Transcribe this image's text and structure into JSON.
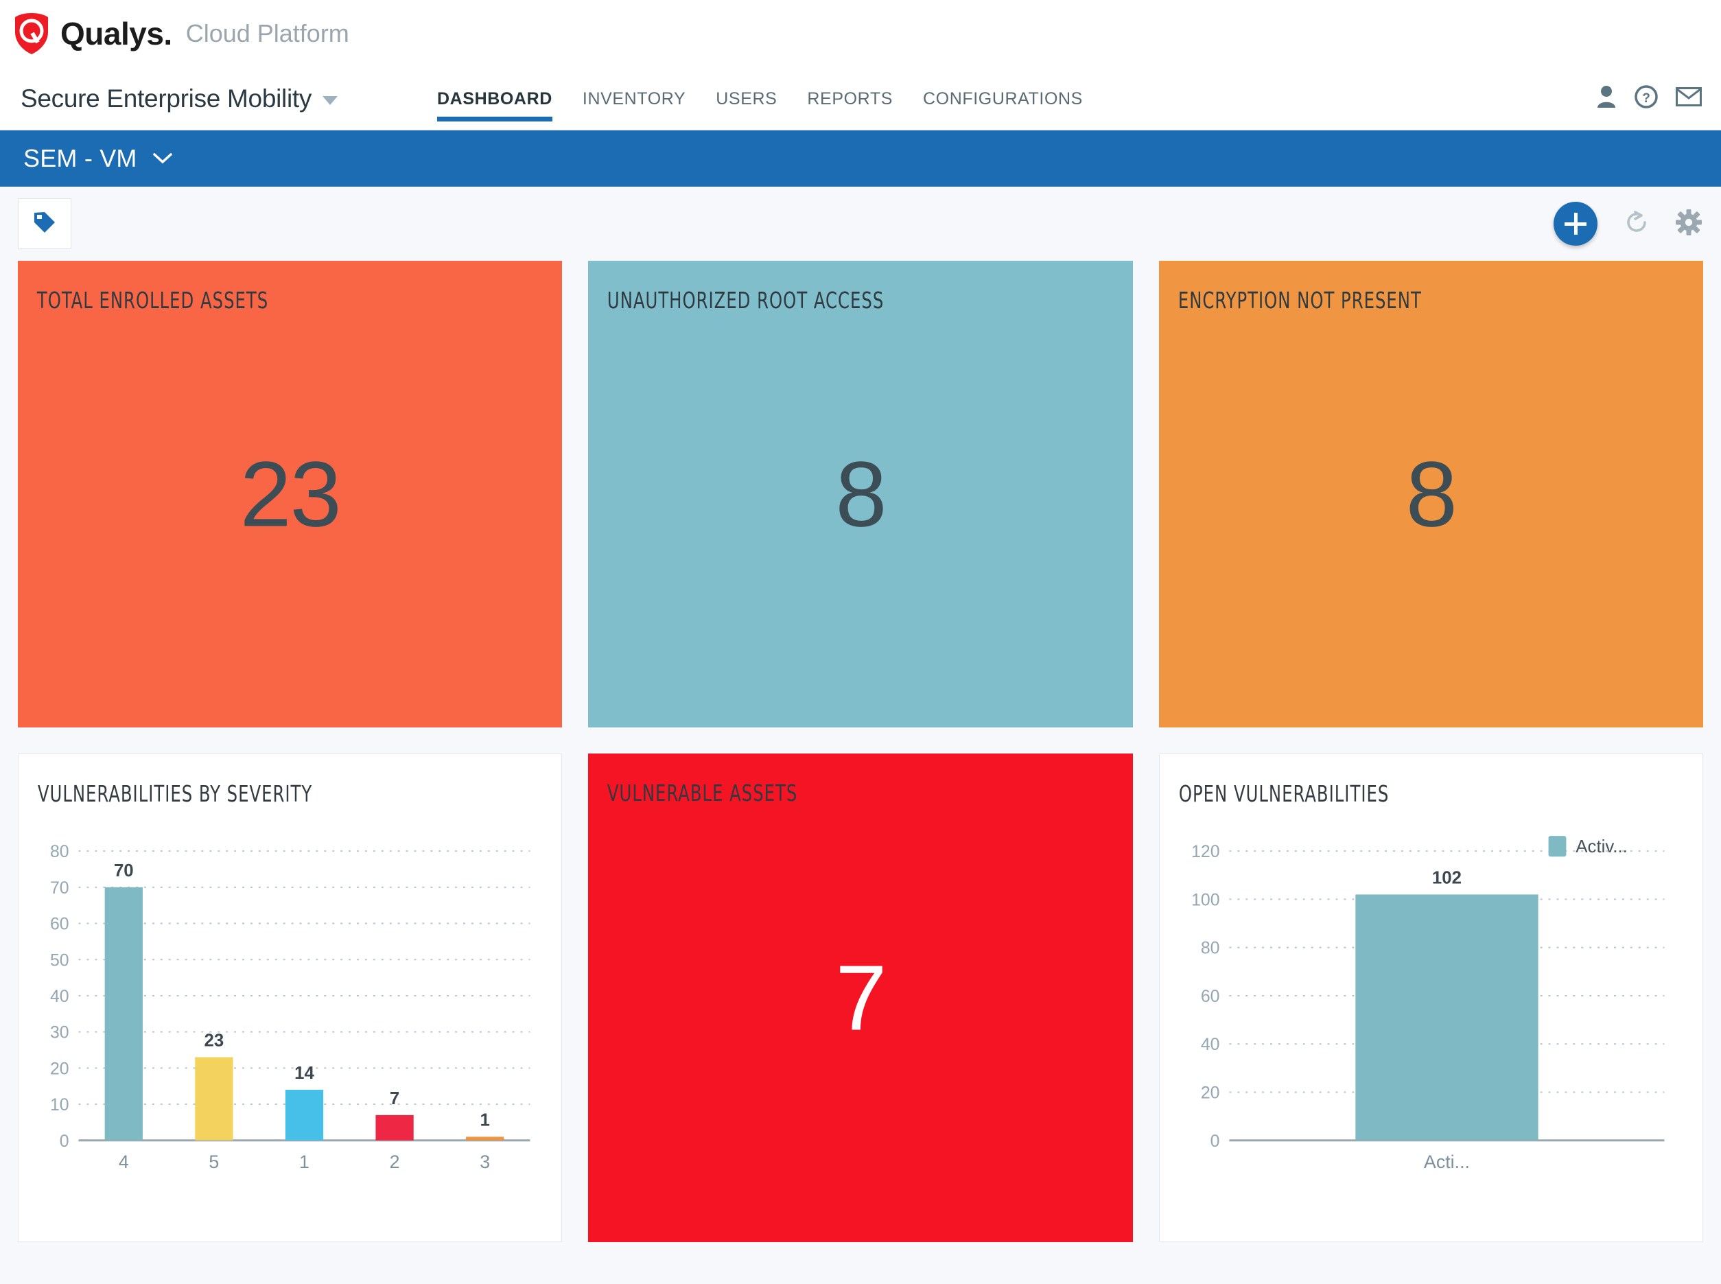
{
  "brand": {
    "name": "Qualys",
    "name_punct": ".",
    "suffix": "Cloud Platform",
    "logo_icon": "qualys-shield-logo",
    "logo_color": "#ED1C24"
  },
  "header": {
    "module_title": "Secure Enterprise Mobility",
    "module_caret_icon": "caret-down-icon",
    "nav": [
      {
        "label": "DASHBOARD",
        "active": true
      },
      {
        "label": "INVENTORY",
        "active": false
      },
      {
        "label": "USERS",
        "active": false
      },
      {
        "label": "REPORTS",
        "active": false
      },
      {
        "label": "CONFIGURATIONS",
        "active": false
      }
    ],
    "actions": [
      {
        "icon": "user-icon"
      },
      {
        "icon": "help-question-icon"
      },
      {
        "icon": "mail-envelope-icon"
      }
    ],
    "active_accent": "#1a6db5"
  },
  "context_bar": {
    "label": "SEM - VM",
    "chevron_icon": "chevron-down-icon",
    "background": "#1b6cb3"
  },
  "toolbar": {
    "tag_icon": "tag-icon",
    "add_icon": "plus-icon",
    "refresh_icon": "refresh-icon",
    "settings_icon": "gear-icon",
    "add_button_color": "#1b6cb3"
  },
  "widgets": [
    {
      "title": "TOTAL ENROLLED ASSETS",
      "value": "23",
      "background": "#f96645",
      "text_color": "#3d4d56",
      "kind": "counter"
    },
    {
      "title": "UNAUTHORIZED ROOT ACCESS",
      "value": "8",
      "background": "#80becb",
      "text_color": "#3d4d56",
      "kind": "counter"
    },
    {
      "title": "ENCRYPTION NOT PRESENT",
      "value": "8",
      "background": "#f09541",
      "text_color": "#3d4d56",
      "kind": "counter"
    },
    {
      "title": "VULNERABILITIES BY SEVERITY",
      "background": "#ffffff",
      "kind": "chart"
    },
    {
      "title": "VULNERABLE ASSETS",
      "value": "7",
      "background": "#f41424",
      "text_color": "#ffffff",
      "kind": "counter"
    },
    {
      "title": "OPEN VULNERABILITIES",
      "background": "#ffffff",
      "kind": "chart"
    }
  ],
  "chart_data": [
    {
      "type": "bar",
      "title": "VULNERABILITIES BY SEVERITY",
      "categories": [
        "4",
        "5",
        "1",
        "2",
        "3"
      ],
      "values": [
        70,
        23,
        14,
        7,
        1
      ],
      "colors": [
        "#7fb9c4",
        "#f3d35e",
        "#46c0e8",
        "#ed2744",
        "#f09541"
      ],
      "xlabel": "",
      "ylabel": "",
      "ylim": [
        0,
        80
      ],
      "yticks": [
        0,
        10,
        20,
        30,
        40,
        50,
        60,
        70,
        80
      ],
      "grid": true,
      "legend": false,
      "data_labels": true
    },
    {
      "type": "bar",
      "title": "OPEN VULNERABILITIES",
      "categories": [
        "Acti..."
      ],
      "values": [
        102
      ],
      "colors": [
        "#7fb9c4"
      ],
      "series": [
        {
          "name": "Activ...",
          "values": [
            102
          ]
        }
      ],
      "xlabel": "",
      "ylabel": "",
      "ylim": [
        0,
        120
      ],
      "yticks": [
        0,
        20,
        40,
        60,
        80,
        100,
        120
      ],
      "grid": true,
      "legend": true,
      "legend_position": "top-right",
      "data_labels": true
    }
  ]
}
